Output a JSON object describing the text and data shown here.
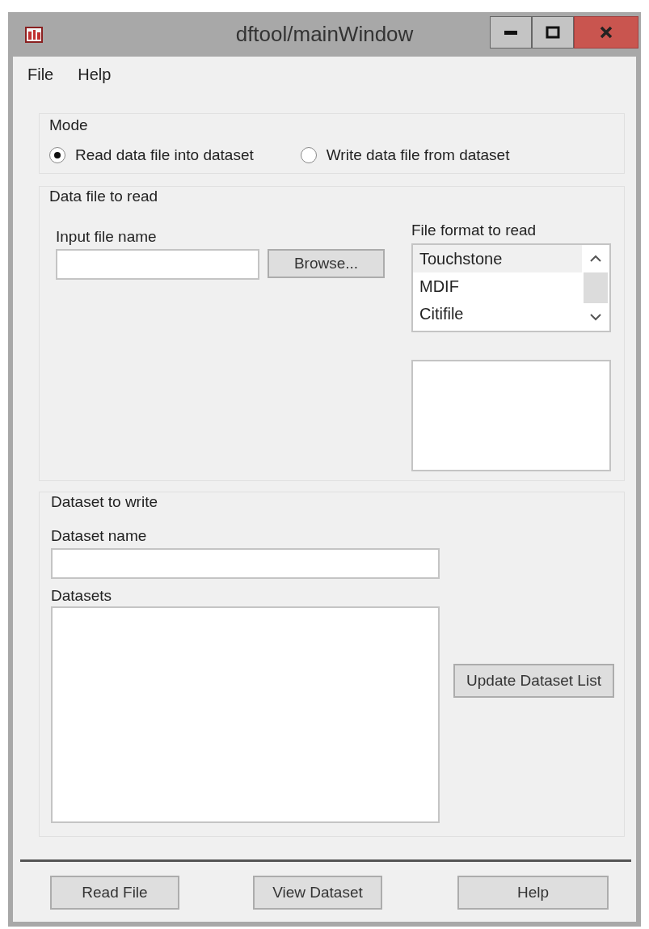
{
  "window": {
    "title": "dftool/mainWindow"
  },
  "menu": [
    {
      "label": "File"
    },
    {
      "label": "Help"
    }
  ],
  "mode": {
    "title": "Mode",
    "options": [
      {
        "label": "Read data file into dataset",
        "selected": true
      },
      {
        "label": "Write data file from dataset",
        "selected": false
      }
    ]
  },
  "read_group": {
    "title": "Data file to read",
    "input_label": "Input file name",
    "browse_button": "Browse...",
    "format_label": "File format to read",
    "formats": [
      {
        "label": "Touchstone",
        "selected": true
      },
      {
        "label": "MDIF",
        "selected": false
      },
      {
        "label": "Citifile",
        "selected": false
      }
    ]
  },
  "write_group": {
    "title": "Dataset to write",
    "name_label": "Dataset name",
    "datasets_label": "Datasets",
    "update_button": "Update Dataset List"
  },
  "buttons": [
    "Read File",
    "View Dataset",
    "Help"
  ]
}
